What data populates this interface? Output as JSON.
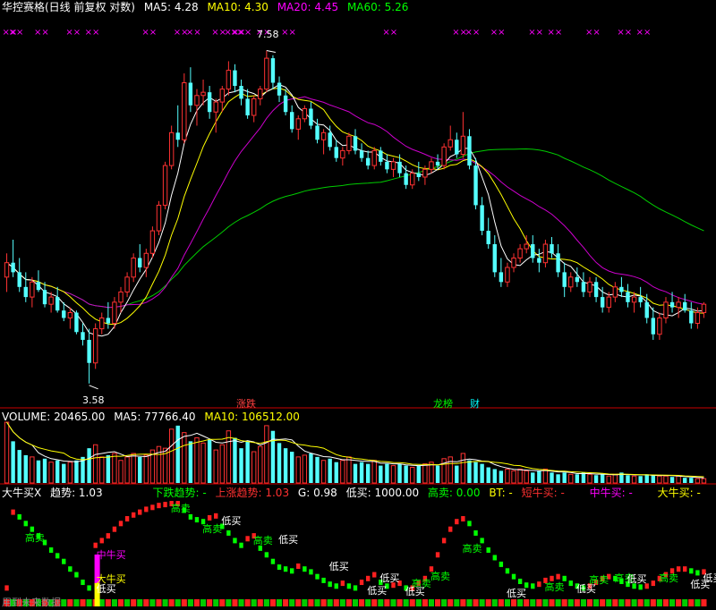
{
  "price_header": {
    "title": "华控赛格(日线 前复权 对数)",
    "ma5": "MA5: 4.28",
    "ma10": "MA10: 4.30",
    "ma20": "MA20: 4.45",
    "ma60": "MA60: 5.26",
    "colors": {
      "title": "#ffffff",
      "ma5": "#ffffff",
      "ma10": "#ffff00",
      "ma20": "#ff00ff",
      "ma60": "#00ff00"
    }
  },
  "volume_header": {
    "volume": "VOLUME: 20465.00",
    "ma5": "MA5: 77766.40",
    "ma10": "MA10: 106512.00"
  },
  "indicator_header": {
    "name": "大牛买X",
    "trend": "趋势: 1.03",
    "down_trend": "下跌趋势: -",
    "up_trend": "上涨趋势: 1.03",
    "g": "G: 0.98",
    "low_buy": "低买: 1000.00",
    "high_sell": "高卖: 0.00",
    "bt": "BT: -",
    "short_buy": "短牛买: -",
    "mid_buy": "中牛买: -",
    "big_buy": "大牛买: -"
  },
  "price_annotations": {
    "high_label": "7.58",
    "low_label": "3.58",
    "event_1": "涨跌",
    "event_2": "龙榜",
    "event_3": "财"
  },
  "indicator_labels": {
    "high_sell": "高卖",
    "low_buy": "低买",
    "mid_bull_buy": "中牛买",
    "big_bull_buy": "大牛买",
    "bottom_text": "用到未来数据"
  },
  "chart_data": {
    "type": "candlestick",
    "title": "华控赛格(日线 前复权 对数)",
    "y_range": [
      3.58,
      7.58
    ],
    "price_high": 7.58,
    "price_low": 3.58,
    "last_values": {
      "ma5": 4.28,
      "ma10": 4.3,
      "ma20": 4.45,
      "ma60": 5.26
    },
    "candles": [
      [
        4.55,
        4.8,
        4.4,
        4.7
      ],
      [
        4.7,
        4.95,
        4.55,
        4.6
      ],
      [
        4.6,
        4.75,
        4.4,
        4.45
      ],
      [
        4.45,
        4.6,
        4.3,
        4.35
      ],
      [
        4.35,
        4.55,
        4.25,
        4.5
      ],
      [
        4.5,
        4.62,
        4.4,
        4.42
      ],
      [
        4.42,
        4.5,
        4.25,
        4.28
      ],
      [
        4.28,
        4.4,
        4.2,
        4.35
      ],
      [
        4.35,
        4.45,
        4.2,
        4.22
      ],
      [
        4.22,
        4.3,
        4.12,
        4.15
      ],
      [
        4.15,
        4.25,
        4.05,
        4.2
      ],
      [
        4.2,
        4.22,
        4.0,
        4.02
      ],
      [
        4.02,
        4.1,
        3.9,
        3.95
      ],
      [
        3.95,
        4.05,
        3.58,
        3.75
      ],
      [
        3.75,
        4.1,
        3.7,
        4.05
      ],
      [
        4.05,
        4.2,
        4.0,
        4.15
      ],
      [
        4.15,
        4.3,
        4.05,
        4.1
      ],
      [
        4.1,
        4.35,
        4.05,
        4.3
      ],
      [
        4.3,
        4.45,
        4.2,
        4.4
      ],
      [
        4.4,
        4.6,
        4.35,
        4.55
      ],
      [
        4.55,
        4.8,
        4.5,
        4.75
      ],
      [
        4.75,
        4.9,
        4.6,
        4.65
      ],
      [
        4.65,
        4.85,
        4.55,
        4.8
      ],
      [
        4.8,
        5.1,
        4.75,
        5.05
      ],
      [
        5.05,
        5.4,
        5.0,
        5.35
      ],
      [
        5.35,
        5.9,
        5.3,
        5.85
      ],
      [
        5.85,
        6.4,
        5.8,
        6.3
      ],
      [
        6.3,
        6.7,
        6.1,
        6.2
      ],
      [
        6.2,
        7.2,
        6.15,
        7.05
      ],
      [
        7.05,
        7.3,
        6.6,
        6.7
      ],
      [
        6.7,
        6.95,
        6.4,
        6.85
      ],
      [
        6.85,
        7.1,
        6.7,
        6.9
      ],
      [
        6.9,
        7.0,
        6.5,
        6.6
      ],
      [
        6.6,
        6.8,
        6.3,
        6.75
      ],
      [
        6.75,
        7.0,
        6.6,
        6.95
      ],
      [
        6.95,
        7.4,
        6.85,
        7.25
      ],
      [
        7.25,
        7.35,
        6.9,
        7.0
      ],
      [
        7.0,
        7.1,
        6.7,
        6.8
      ],
      [
        6.8,
        6.95,
        6.5,
        6.55
      ],
      [
        6.55,
        6.85,
        6.45,
        6.8
      ],
      [
        6.8,
        7.0,
        6.7,
        6.95
      ],
      [
        6.95,
        7.58,
        6.9,
        7.45
      ],
      [
        7.45,
        7.5,
        6.95,
        7.05
      ],
      [
        7.05,
        7.15,
        6.75,
        6.85
      ],
      [
        6.85,
        6.95,
        6.55,
        6.6
      ],
      [
        6.6,
        6.7,
        6.3,
        6.35
      ],
      [
        6.35,
        6.55,
        6.2,
        6.5
      ],
      [
        6.5,
        6.7,
        6.45,
        6.65
      ],
      [
        6.65,
        6.75,
        6.35,
        6.4
      ],
      [
        6.4,
        6.5,
        6.15,
        6.2
      ],
      [
        6.2,
        6.35,
        6.0,
        6.3
      ],
      [
        6.3,
        6.4,
        6.05,
        6.1
      ],
      [
        6.1,
        6.2,
        5.9,
        5.95
      ],
      [
        5.95,
        6.1,
        5.85,
        6.05
      ],
      [
        6.05,
        6.3,
        6.0,
        6.25
      ],
      [
        6.25,
        6.35,
        6.0,
        6.05
      ],
      [
        6.05,
        6.15,
        5.9,
        5.95
      ],
      [
        5.95,
        6.05,
        5.8,
        5.85
      ],
      [
        5.85,
        6.1,
        5.8,
        6.05
      ],
      [
        6.05,
        6.1,
        5.85,
        5.9
      ],
      [
        5.9,
        6.0,
        5.75,
        5.8
      ],
      [
        5.8,
        5.95,
        5.7,
        5.9
      ],
      [
        5.9,
        6.0,
        5.7,
        5.75
      ],
      [
        5.75,
        5.85,
        5.55,
        5.6
      ],
      [
        5.6,
        5.8,
        5.55,
        5.75
      ],
      [
        5.75,
        5.9,
        5.65,
        5.7
      ],
      [
        5.7,
        5.85,
        5.6,
        5.8
      ],
      [
        5.8,
        5.95,
        5.75,
        5.9
      ],
      [
        5.9,
        6.0,
        5.8,
        5.85
      ],
      [
        5.85,
        6.15,
        5.8,
        6.1
      ],
      [
        6.1,
        6.4,
        6.05,
        6.2
      ],
      [
        6.2,
        6.3,
        5.95,
        6.0
      ],
      [
        6.0,
        6.6,
        5.95,
        6.25
      ],
      [
        6.25,
        6.35,
        5.8,
        5.85
      ],
      [
        5.85,
        5.95,
        5.3,
        5.35
      ],
      [
        5.35,
        5.45,
        5.0,
        5.05
      ],
      [
        5.05,
        5.2,
        4.85,
        4.9
      ],
      [
        4.9,
        5.0,
        4.55,
        4.6
      ],
      [
        4.6,
        4.75,
        4.45,
        4.5
      ],
      [
        4.5,
        4.7,
        4.45,
        4.65
      ],
      [
        4.65,
        4.8,
        4.6,
        4.75
      ],
      [
        4.75,
        4.9,
        4.7,
        4.85
      ],
      [
        4.85,
        5.0,
        4.8,
        4.9
      ],
      [
        4.9,
        5.0,
        4.7,
        4.75
      ],
      [
        4.75,
        4.85,
        4.6,
        4.7
      ],
      [
        4.7,
        4.95,
        4.65,
        4.9
      ],
      [
        4.9,
        4.98,
        4.75,
        4.8
      ],
      [
        4.8,
        4.9,
        4.55,
        4.6
      ],
      [
        4.6,
        4.7,
        4.35,
        4.45
      ],
      [
        4.45,
        4.6,
        4.4,
        4.55
      ],
      [
        4.55,
        4.65,
        4.45,
        4.5
      ],
      [
        4.5,
        4.6,
        4.35,
        4.4
      ],
      [
        4.4,
        4.55,
        4.35,
        4.5
      ],
      [
        4.5,
        4.55,
        4.3,
        4.35
      ],
      [
        4.35,
        4.45,
        4.2,
        4.25
      ],
      [
        4.25,
        4.4,
        4.2,
        4.35
      ],
      [
        4.35,
        4.5,
        4.3,
        4.45
      ],
      [
        4.45,
        4.55,
        4.35,
        4.4
      ],
      [
        4.4,
        4.48,
        4.25,
        4.3
      ],
      [
        4.3,
        4.4,
        4.2,
        4.35
      ],
      [
        4.35,
        4.45,
        4.25,
        4.3
      ],
      [
        4.3,
        4.38,
        4.1,
        4.15
      ],
      [
        4.15,
        4.25,
        3.95,
        4.0
      ],
      [
        4.0,
        4.2,
        3.95,
        4.15
      ],
      [
        4.15,
        4.35,
        4.1,
        4.3
      ],
      [
        4.3,
        4.4,
        4.2,
        4.25
      ],
      [
        4.25,
        4.35,
        4.15,
        4.3
      ],
      [
        4.3,
        4.38,
        4.2,
        4.22
      ],
      [
        4.22,
        4.3,
        4.05,
        4.1
      ],
      [
        4.1,
        4.25,
        4.05,
        4.2
      ],
      [
        4.2,
        4.3,
        4.15,
        4.28
      ]
    ],
    "volumes": [
      70,
      48,
      38,
      32,
      30,
      26,
      28,
      24,
      26,
      22,
      24,
      26,
      30,
      40,
      44,
      30,
      32,
      34,
      26,
      30,
      34,
      30,
      32,
      38,
      42,
      40,
      62,
      66,
      58,
      48,
      52,
      46,
      50,
      38,
      44,
      60,
      52,
      40,
      48,
      36,
      42,
      66,
      60,
      46,
      40,
      36,
      30,
      32,
      34,
      30,
      26,
      28,
      24,
      26,
      30,
      22,
      24,
      22,
      26,
      20,
      22,
      20,
      22,
      20,
      18,
      20,
      22,
      24,
      20,
      28,
      30,
      20,
      34,
      26,
      24,
      22,
      18,
      16,
      14,
      16,
      14,
      16,
      14,
      12,
      14,
      16,
      12,
      10,
      12,
      10,
      10,
      12,
      10,
      9,
      10,
      8,
      10,
      12,
      9,
      8,
      8,
      10,
      9,
      8,
      8,
      7,
      8,
      6,
      6,
      5,
      5
    ],
    "indicator": [
      0.1,
      0.9,
      0.85,
      0.78,
      0.72,
      0.65,
      0.58,
      0.5,
      0.44,
      0.38,
      0.3,
      0.24,
      0.16,
      0.1,
      0.55,
      0.6,
      0.65,
      0.72,
      0.78,
      0.83,
      0.87,
      0.9,
      0.93,
      0.95,
      0.97,
      0.98,
      0.99,
      0.99,
      0.92,
      0.85,
      0.82,
      0.8,
      0.84,
      0.86,
      0.75,
      0.68,
      0.6,
      0.55,
      0.62,
      0.65,
      0.52,
      0.45,
      0.38,
      0.32,
      0.3,
      0.28,
      0.33,
      0.3,
      0.27,
      0.22,
      0.18,
      0.14,
      0.12,
      0.15,
      0.12,
      0.1,
      0.16,
      0.2,
      0.24,
      0.16,
      0.12,
      0.13,
      0.15,
      0.1,
      0.1,
      0.15,
      0.2,
      0.3,
      0.45,
      0.6,
      0.72,
      0.8,
      0.83,
      0.78,
      0.68,
      0.6,
      0.5,
      0.42,
      0.35,
      0.28,
      0.22,
      0.17,
      0.13,
      0.12,
      0.14,
      0.18,
      0.2,
      0.22,
      0.2,
      0.15,
      0.12,
      0.1,
      0.12,
      0.16,
      0.2,
      0.22,
      0.2,
      0.17,
      0.14,
      0.12,
      0.11,
      0.12,
      0.15,
      0.2,
      0.24,
      0.28,
      0.3,
      0.3,
      0.28,
      0.26,
      0.27
    ]
  }
}
